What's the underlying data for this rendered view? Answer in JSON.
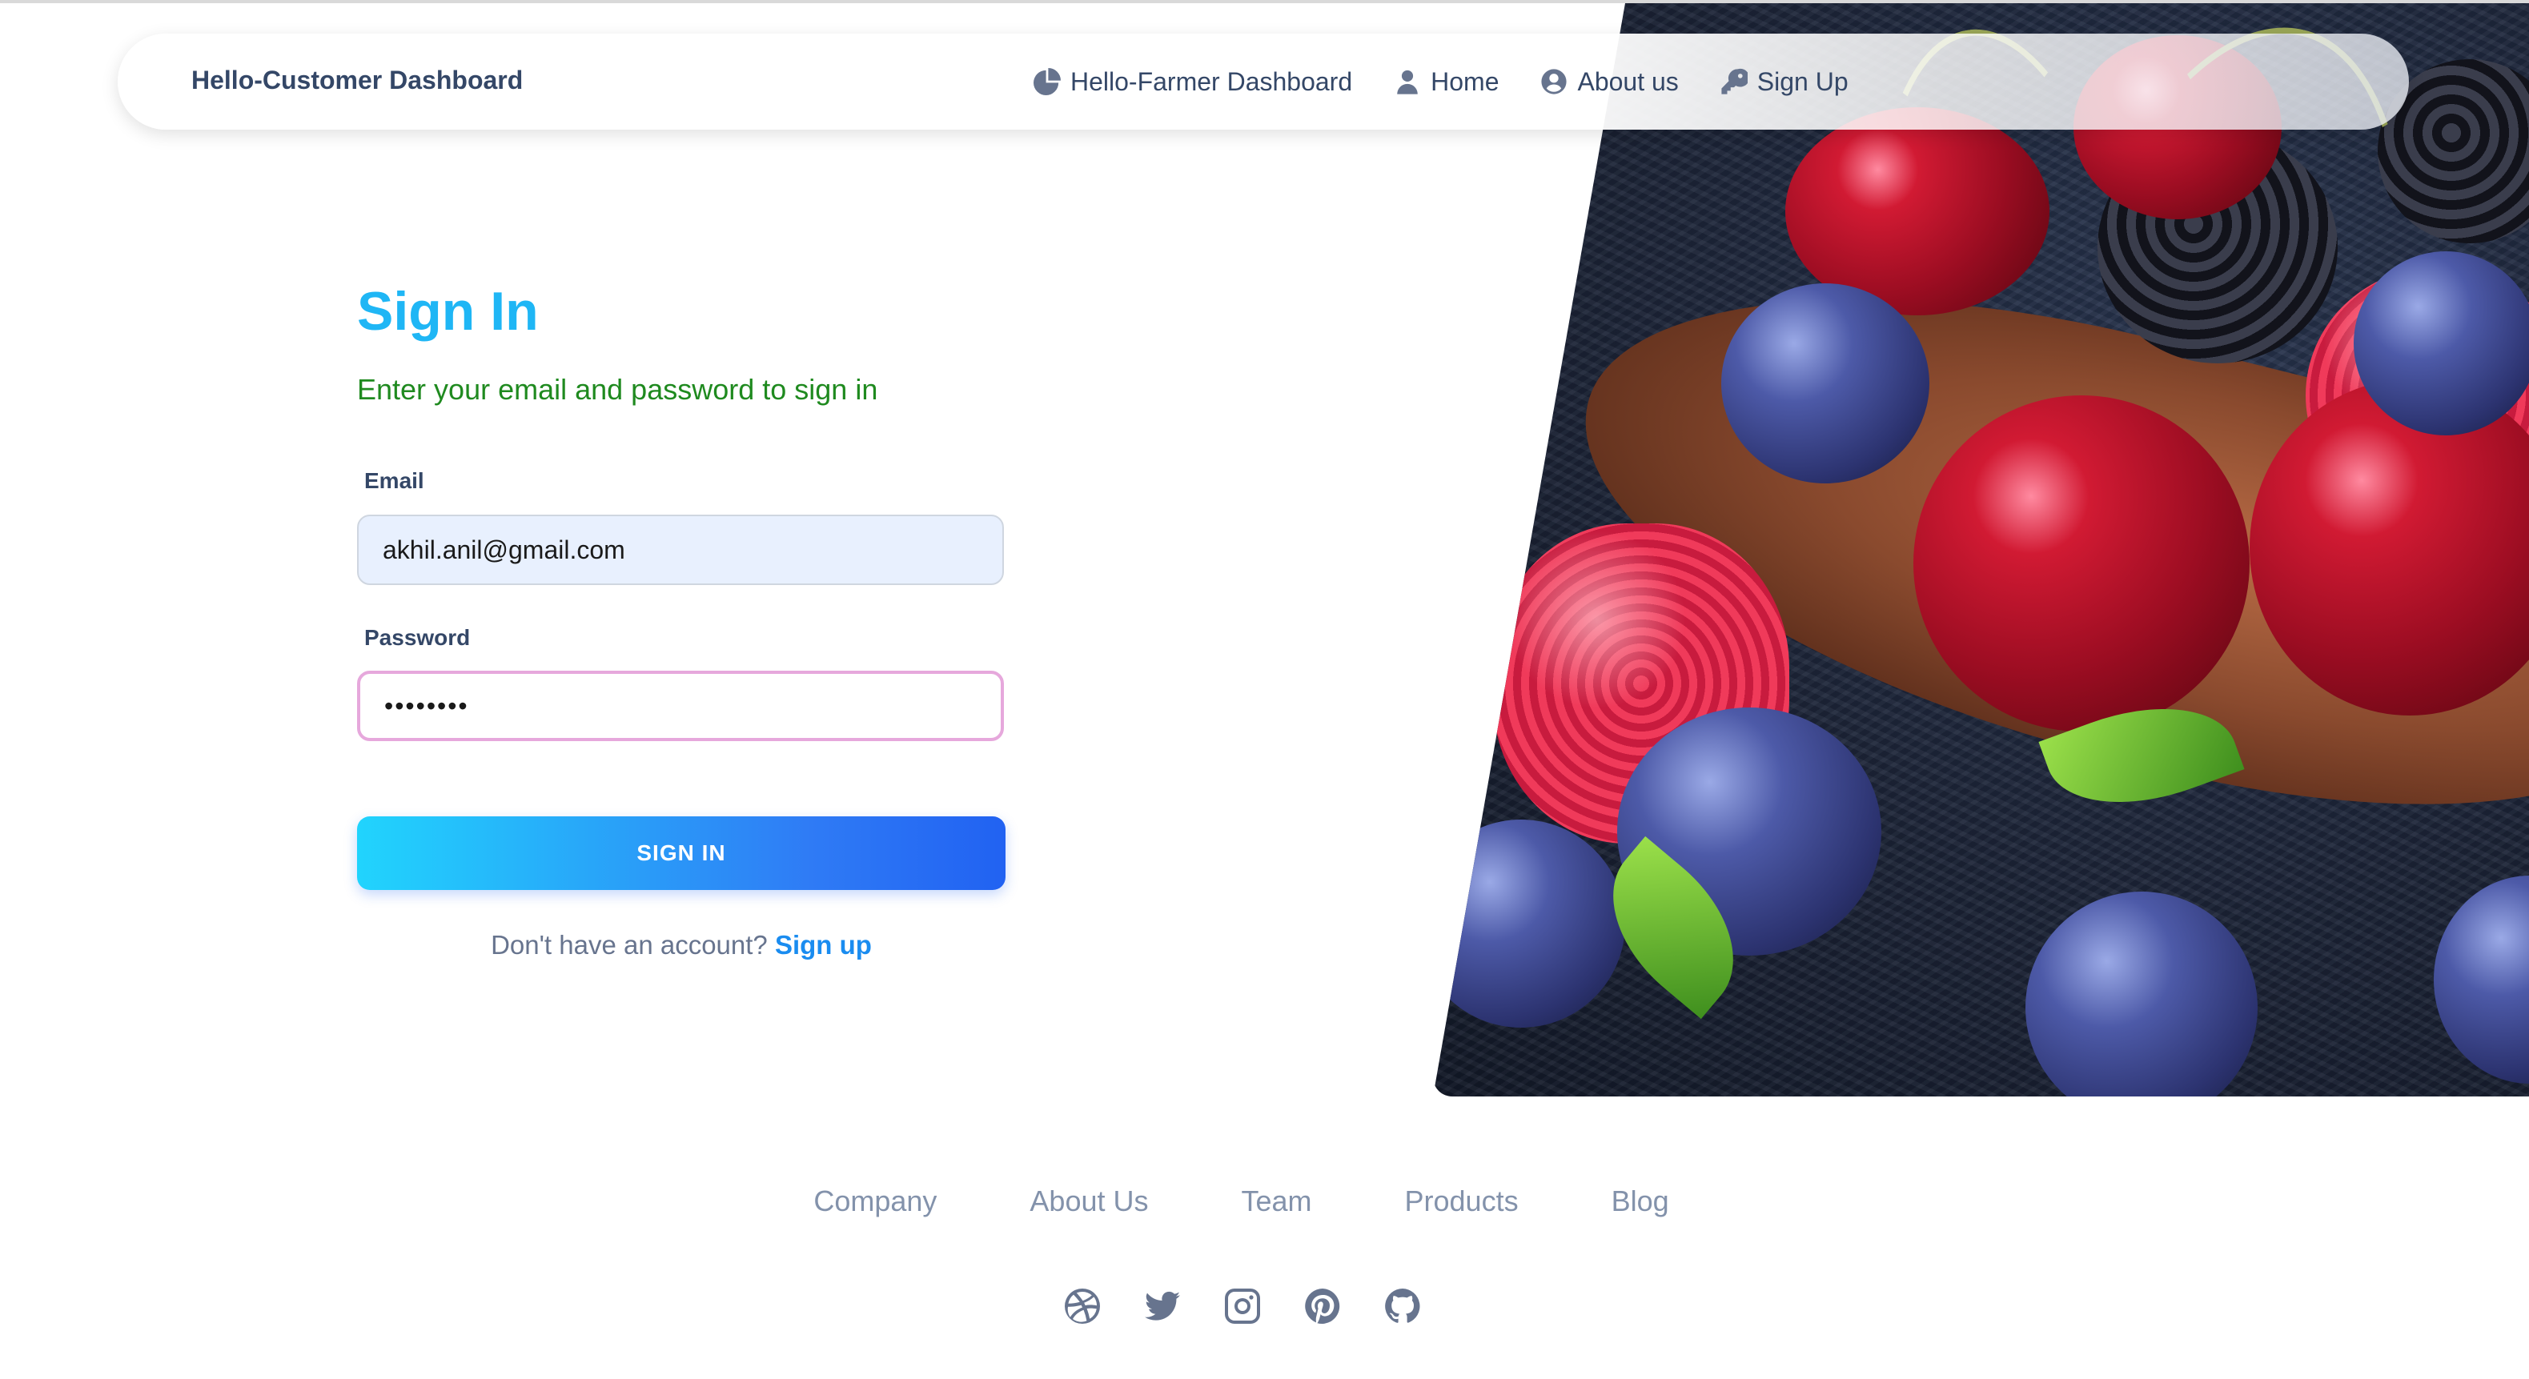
{
  "navbar": {
    "brand": "Hello-Customer Dashboard",
    "links": [
      {
        "label": "Hello-Farmer Dashboard",
        "icon": "pie-chart-icon"
      },
      {
        "label": "Home",
        "icon": "user-icon"
      },
      {
        "label": "About us",
        "icon": "user-circle-icon"
      },
      {
        "label": "Sign Up",
        "icon": "key-icon"
      }
    ]
  },
  "signin": {
    "title": "Sign In",
    "subtitle": "Enter your email and password to sign in",
    "email_label": "Email",
    "email_value": "akhil.anil@gmail.com",
    "password_label": "Password",
    "password_value": "••••••••",
    "button_label": "SIGN IN",
    "prompt_text": "Don't have an account?",
    "signup_link": "Sign up"
  },
  "footer": {
    "links": [
      "Company",
      "About Us",
      "Team",
      "Products",
      "Blog"
    ],
    "socials": [
      "dribbble-icon",
      "twitter-icon",
      "instagram-icon",
      "pinterest-icon",
      "github-icon"
    ]
  },
  "colors": {
    "title": "#1fb6f5",
    "subtitle": "#1f8a1f",
    "button_start": "#21d4fd",
    "button_end": "#2162f2",
    "link": "#1a8cf0"
  }
}
